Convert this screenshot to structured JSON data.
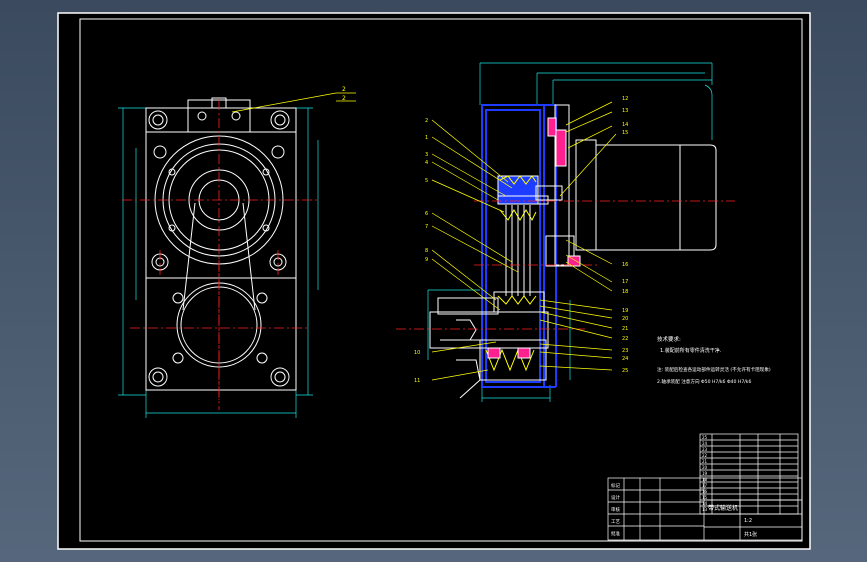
{
  "colors": {
    "background": "#000000",
    "frame": "#ffffff",
    "outline": "#ffffff",
    "centerline": "#ff2020",
    "dimension": "#19e6e6",
    "leader": "#ffff00",
    "housing": "#1e3cff",
    "part_fill": "#ff2090",
    "hatch": "#ffff00",
    "motor": "#ffffff"
  },
  "drawing": {
    "front_view_labels": [
      "2",
      "2"
    ],
    "section_left_labels": [
      "2",
      "1",
      "3",
      "4",
      "5",
      "6",
      "7",
      "8",
      "9",
      "10",
      "11"
    ],
    "section_right_labels": [
      "12",
      "13",
      "14",
      "15",
      "16",
      "17",
      "18",
      "19",
      "20",
      "21",
      "22",
      "23",
      "24",
      "25"
    ],
    "tech_notes": [
      "技术要求:",
      "1.装配前所有零件清洗干净.",
      "注: 装配后检查各运动部件运转灵活 (不允许有卡阻现象)",
      "2.轴承装配 注意方向 Φ50 H7/k6    Φ40 H7/k6"
    ]
  },
  "title_block": {
    "rows": [
      "标记",
      "设计",
      "审核",
      "工艺",
      "批准"
    ],
    "title": "带式输送机",
    "scale": "1:2",
    "sheet": "共1张"
  },
  "parts_list": {
    "rows": [
      "25",
      "24",
      "23",
      "22",
      "21",
      "20",
      "19",
      "18",
      "17",
      "16",
      "15",
      "14",
      "13",
      "12"
    ]
  }
}
